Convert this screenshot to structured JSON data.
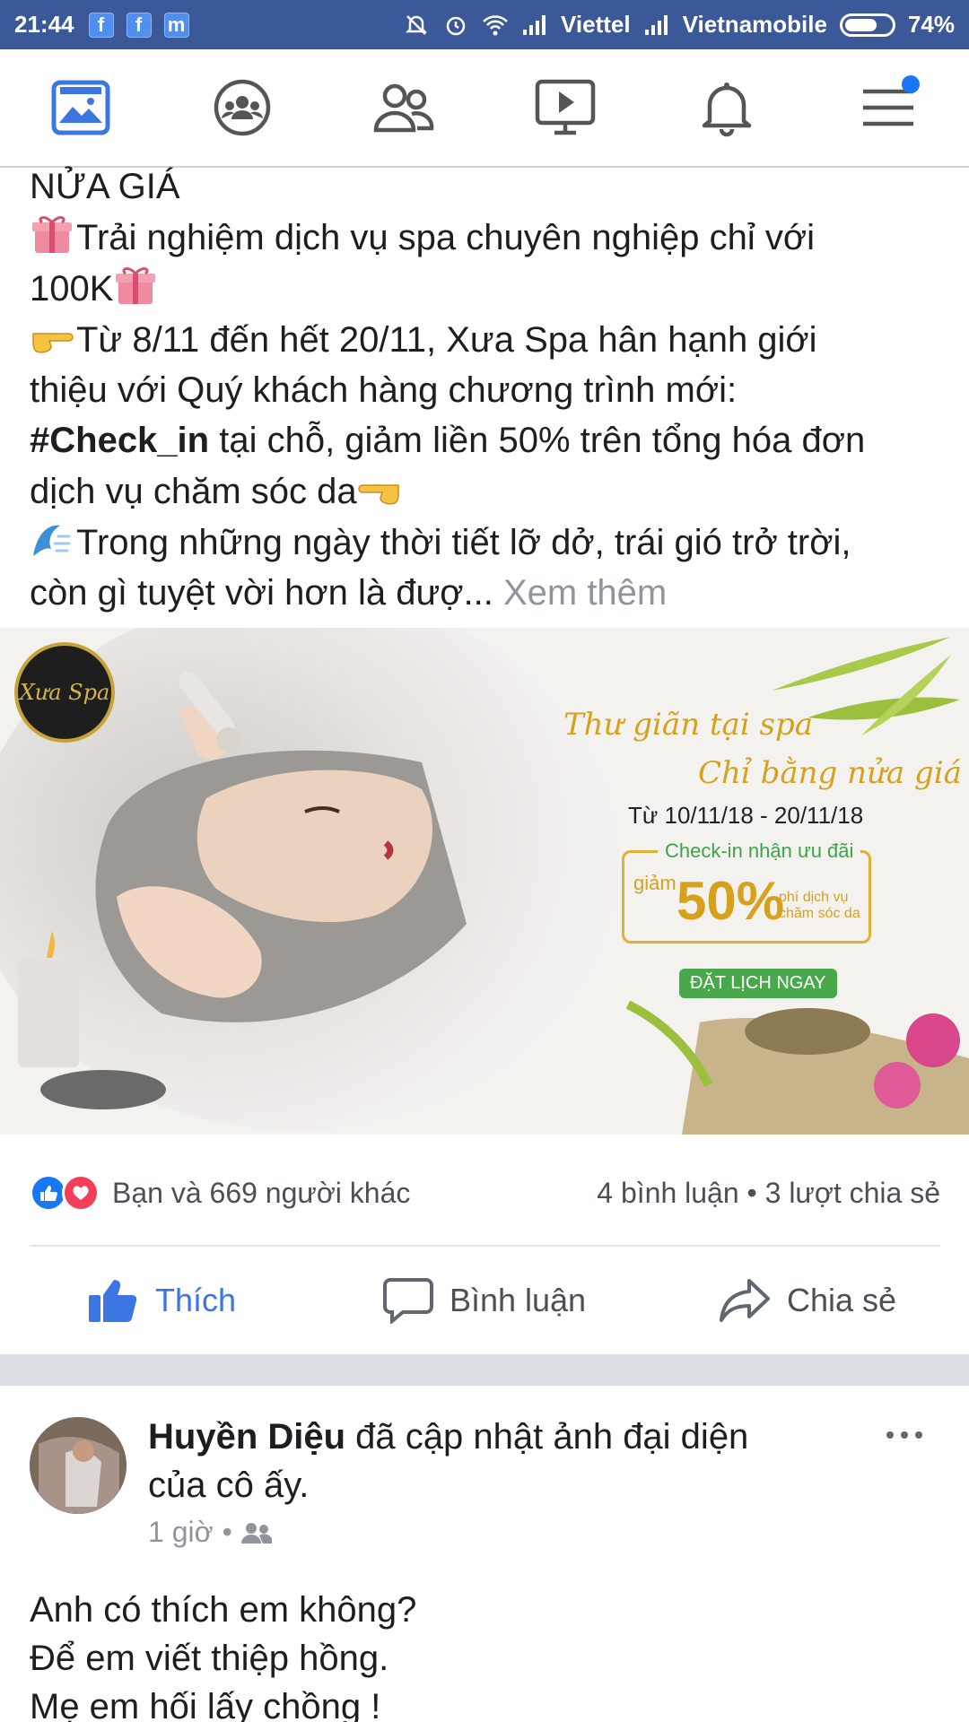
{
  "status_bar": {
    "time": "21:44",
    "apps": [
      "f",
      "f",
      "m"
    ],
    "carrier1": "Viettel",
    "carrier2": "Vietnamobile",
    "battery": "74%",
    "battery_level": 0.74
  },
  "nav": {
    "items": [
      "news-feed",
      "groups",
      "friends",
      "watch",
      "notifications",
      "menu"
    ],
    "active": "news-feed"
  },
  "post1": {
    "line1": "NỬA GIÁ",
    "line2": "Trải nghiệm dịch vụ spa chuyên nghiệp chỉ với",
    "line3": "100K",
    "line4": "Từ 8/11 đến hết 20/11, Xưa Spa hân hạnh giới",
    "line5": "thiệu với Quý khách hàng chương trình mới:",
    "line6_hashtag": "#Check_in",
    "line6_rest": " tại chỗ, giảm liền 50% trên tổng hóa đơn",
    "line7": "dịch vụ chăm sóc da",
    "line8": "Trong những ngày thời tiết lỡ dở, trái gió trở trời,",
    "line9": "còn gì tuyệt vời hơn là đượ...",
    "see_more": "Xem thêm",
    "ad": {
      "logo_text": "Xưa Spa",
      "title1": "Thư giãn tại spa",
      "title2": "Chỉ bằng nửa giá",
      "dates": "Từ 10/11/18 - 20/11/18",
      "box_head": "Check-in nhận ưu đãi",
      "giam": "giảm",
      "percent": "50%",
      "sub1": "phí dịch vụ",
      "sub2": "chăm sóc da",
      "cta": "ĐẶT LỊCH NGAY"
    },
    "reactions_text": "Bạn và 669 người khác",
    "comments_shares": "4 bình luận • 3 lượt chia sẻ",
    "actions": {
      "like": "Thích",
      "comment": "Bình luận",
      "share": "Chia sẻ"
    }
  },
  "post2": {
    "author": "Huyền Diệu",
    "action_text": " đã cập nhật ảnh đại diện",
    "action_text2": "của cô ấy.",
    "time": "1 giờ",
    "dot": "•",
    "lines": [
      "Anh có thích em không?",
      "Để em viết thiệp hồng.",
      "Mẹ em hối lấy chồng !"
    ]
  },
  "colors": {
    "brand": "#3b5998",
    "like_blue": "#3b76e3",
    "love_red": "#f33e58",
    "muted": "#90949c"
  }
}
